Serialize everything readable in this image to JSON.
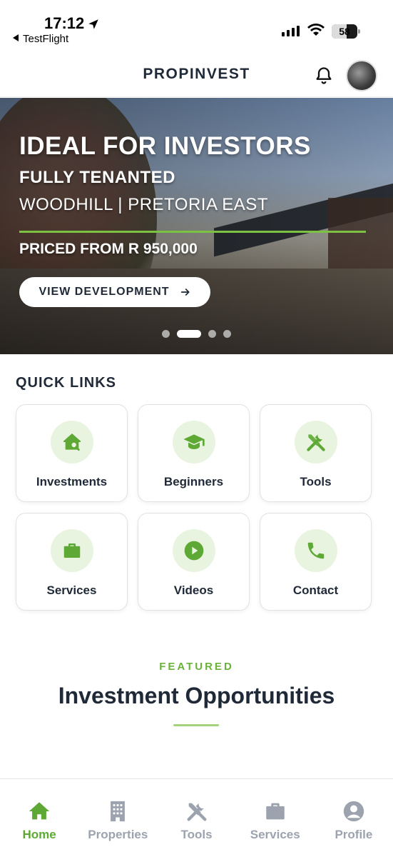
{
  "status_bar": {
    "time": "17:12",
    "back_label": "TestFlight",
    "battery": "58",
    "battery_level": 0.58
  },
  "header": {
    "title": "PROPINVEST"
  },
  "hero": {
    "title": "IDEAL FOR INVESTORS",
    "subtitle": "FULLY TENANTED",
    "location": "WOODHILL | PRETORIA EAST",
    "price": "PRICED FROM R 950,000",
    "button_label": "VIEW DEVELOPMENT",
    "slide_count": 4,
    "active_slide": 2
  },
  "quick_links": {
    "title": "QUICK LINKS",
    "items": [
      {
        "label": "Investments",
        "icon": "house-search-icon"
      },
      {
        "label": "Beginners",
        "icon": "graduation-cap-icon"
      },
      {
        "label": "Tools",
        "icon": "tools-icon"
      },
      {
        "label": "Services",
        "icon": "briefcase-icon"
      },
      {
        "label": "Videos",
        "icon": "play-icon"
      },
      {
        "label": "Contact",
        "icon": "phone-icon"
      }
    ]
  },
  "featured": {
    "kicker": "FEATURED",
    "title": "Investment Opportunities"
  },
  "bottom_nav": {
    "items": [
      {
        "label": "Home",
        "icon": "home-icon",
        "active": true
      },
      {
        "label": "Properties",
        "icon": "building-icon",
        "active": false
      },
      {
        "label": "Tools",
        "icon": "tools-icon",
        "active": false
      },
      {
        "label": "Services",
        "icon": "briefcase-icon",
        "active": false
      },
      {
        "label": "Profile",
        "icon": "user-circle-icon",
        "active": false
      }
    ]
  },
  "colors": {
    "accent": "#5ea935",
    "accent_light": "#e8f4df",
    "text_dark": "#1f2937",
    "muted": "#9ca3af"
  }
}
